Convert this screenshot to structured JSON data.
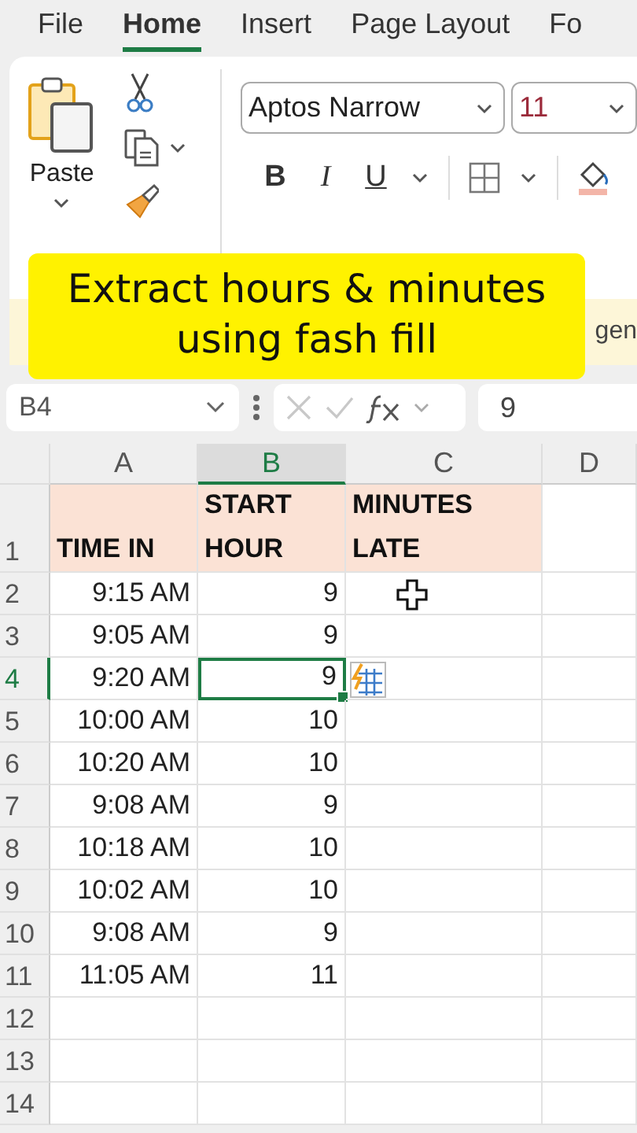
{
  "menu_tabs": [
    {
      "label": "File",
      "selected": false
    },
    {
      "label": "Home",
      "selected": true
    },
    {
      "label": "Insert",
      "selected": false
    },
    {
      "label": "Page Layout",
      "selected": false
    },
    {
      "label": "Fo",
      "selected": false
    }
  ],
  "ribbon": {
    "paste_label": "Paste",
    "font_name": "Aptos Narrow",
    "font_size": "11",
    "format_buttons": [
      "B",
      "I",
      "U"
    ],
    "notice_text": "gen"
  },
  "caption": {
    "text": "Extract hours & minutes\nusing fash fill"
  },
  "formula_bar": {
    "name_box": "B4",
    "value": "9"
  },
  "sheet": {
    "columns": [
      {
        "label": "A",
        "selected": false
      },
      {
        "label": "B",
        "selected": true
      },
      {
        "label": "C",
        "selected": false
      },
      {
        "label": "D",
        "selected": false
      }
    ],
    "header_row": {
      "number": "1",
      "cells": [
        "TIME IN",
        "START\nHOUR",
        "MINUTES\nLATE"
      ]
    },
    "rows": [
      {
        "number": "2",
        "time_in": "9:15 AM",
        "start_hour": "9",
        "selected": false
      },
      {
        "number": "3",
        "time_in": "9:05 AM",
        "start_hour": "9",
        "selected": false
      },
      {
        "number": "4",
        "time_in": "9:20 AM",
        "start_hour": "9",
        "selected": true
      },
      {
        "number": "5",
        "time_in": "10:00 AM",
        "start_hour": "10",
        "selected": false
      },
      {
        "number": "6",
        "time_in": "10:20 AM",
        "start_hour": "10",
        "selected": false
      },
      {
        "number": "7",
        "time_in": "9:08 AM",
        "start_hour": "9",
        "selected": false
      },
      {
        "number": "8",
        "time_in": "10:18 AM",
        "start_hour": "10",
        "selected": false
      },
      {
        "number": "9",
        "time_in": "10:02 AM",
        "start_hour": "10",
        "selected": false
      },
      {
        "number": "10",
        "time_in": "9:08 AM",
        "start_hour": "9",
        "selected": false
      },
      {
        "number": "11",
        "time_in": "11:05 AM",
        "start_hour": "11",
        "selected": false
      },
      {
        "number": "12",
        "selected": false
      },
      {
        "number": "13",
        "selected": false
      },
      {
        "number": "14",
        "selected": false
      }
    ]
  }
}
